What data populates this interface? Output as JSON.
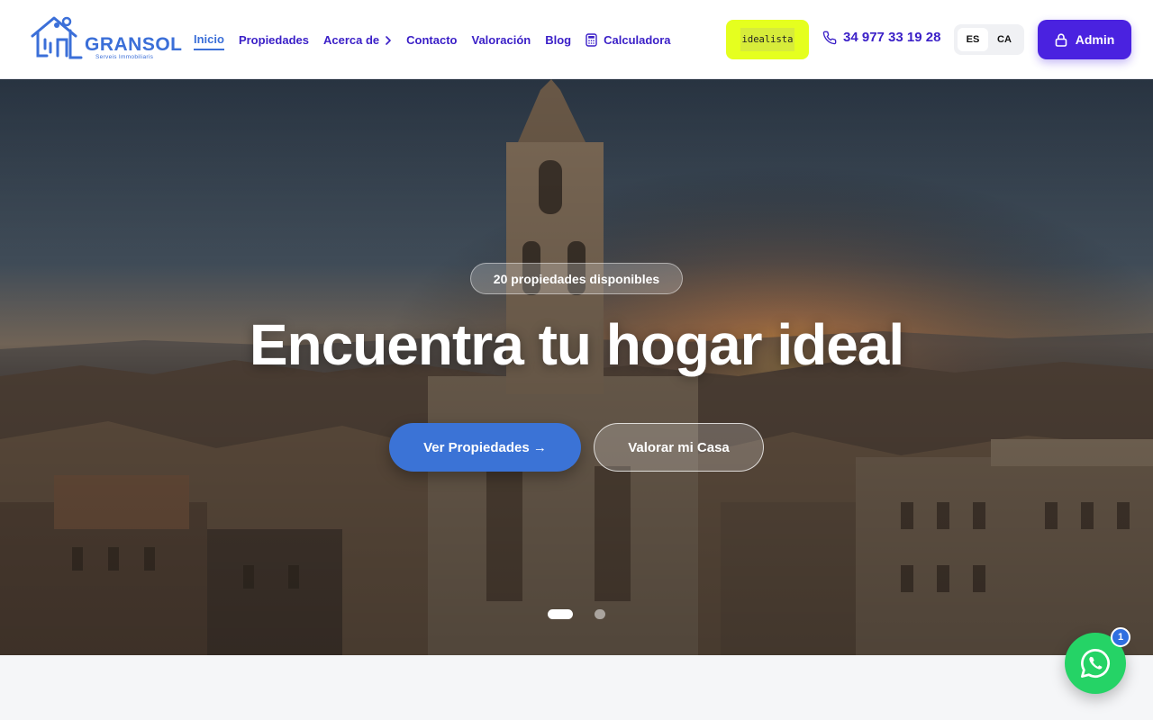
{
  "brand": {
    "name": "GRANSOL",
    "tagline": "Serveis Immobiliaris",
    "color": "#3b6fd8"
  },
  "nav": {
    "items": [
      {
        "label": "Inicio",
        "active": true
      },
      {
        "label": "Propiedades"
      },
      {
        "label": "Acerca de",
        "icon": "chevron-right-icon"
      },
      {
        "label": "Contacto"
      },
      {
        "label": "Valoración"
      },
      {
        "label": "Blog"
      },
      {
        "label": "Calculadora",
        "icon": "calculator-icon"
      }
    ]
  },
  "header": {
    "idealista_label": "idealista",
    "phone": "34 977 33 19 28",
    "phone_icon": "phone-icon",
    "languages": [
      "ES",
      "CA"
    ],
    "selected_language": "ES",
    "admin_label": "Admin",
    "admin_icon": "lock-icon"
  },
  "hero": {
    "badge": "20 propiedades disponibles",
    "title": "Encuentra tu hogar ideal",
    "primary_button": "Ver Propiedades →",
    "secondary_button": "Valorar mi Casa",
    "slides_total": 2,
    "slide_active": 1
  },
  "whatsapp": {
    "icon": "whatsapp-icon",
    "badge": "1"
  },
  "colors": {
    "nav_text": "#3a1fc7",
    "accent": "#3b73d6",
    "admin_bg": "#4a22e0",
    "idealista_bg": "#e5ff1f",
    "whatsapp": "#25d366"
  }
}
